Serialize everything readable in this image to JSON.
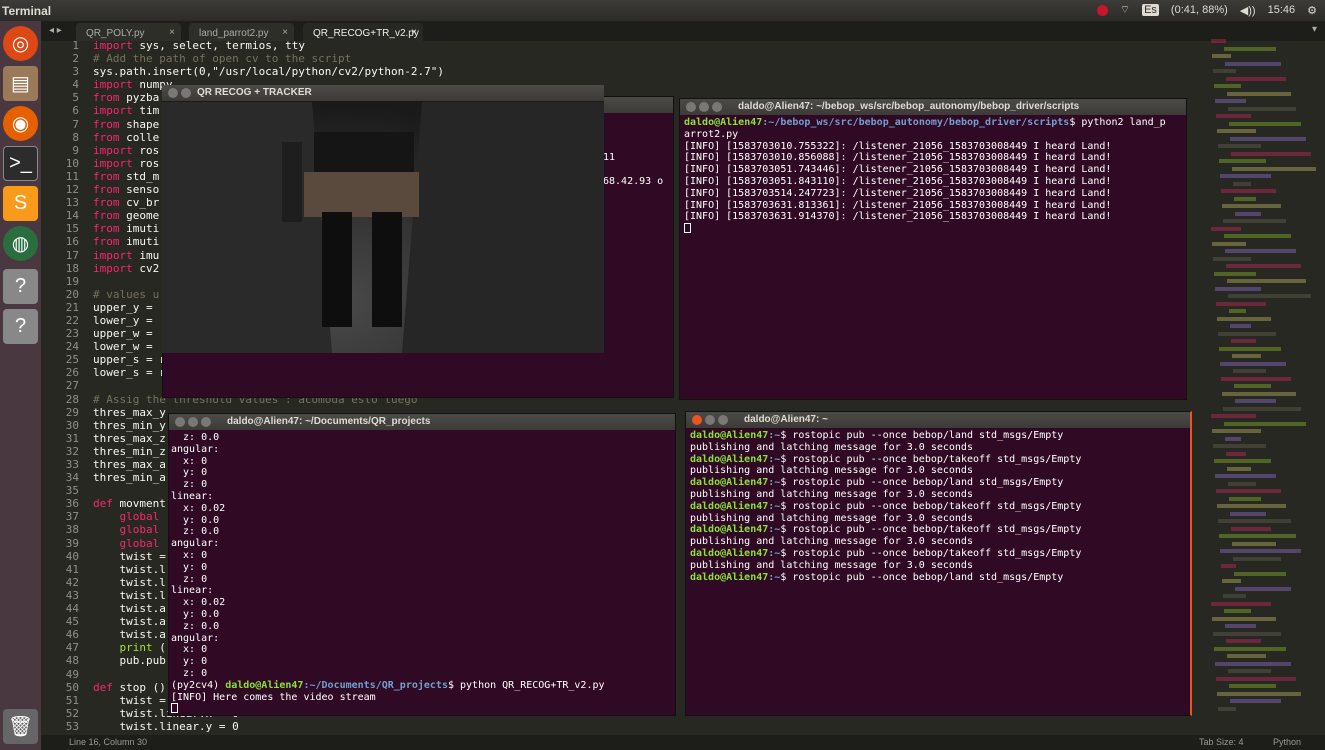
{
  "topbar": {
    "title": "Terminal",
    "keyboard": "Es",
    "battery": "(0:41, 88%)",
    "volume": "◀))",
    "time": "15:46"
  },
  "launcher": {
    "items": [
      "ubuntu-icon",
      "files-icon",
      "firefox-icon",
      "terminal-icon",
      "sublime-icon",
      "browser-icon",
      "unknown-icon",
      "unknown-icon",
      "trash-icon"
    ]
  },
  "editor": {
    "tabs": [
      "QR_POLY.py",
      "land_parrot2.py",
      "QR_RECOG+TR_v2.py"
    ],
    "status": {
      "position": "Line 16, Column 30",
      "tab_size": "Tab Size: 4",
      "language": "Python"
    },
    "line_numbers": [
      "1",
      "2",
      "3",
      "4",
      "5",
      "6",
      "7",
      "8",
      "9",
      "10",
      "11",
      "12",
      "13",
      "14",
      "15",
      "16",
      "17",
      "18",
      "19",
      "20",
      "21",
      "22",
      "23",
      "24",
      "25",
      "26",
      "27",
      "28",
      "29",
      "30",
      "31",
      "32",
      "33",
      "34",
      "35",
      "36",
      "37",
      "38",
      "39",
      "40",
      "41",
      "42",
      "43",
      "44",
      "45",
      "46",
      "47",
      "48",
      "49",
      "50",
      "51",
      "52",
      "53"
    ],
    "code": [
      "import sys, select, termios, tty",
      "# Add the path of open cv to the script",
      "sys.path.insert(0,\"/usr/local/python/cv2/python-2.7\")",
      "import numpy",
      "from pyzba",
      "import tim",
      "from shape",
      "from colle",
      "import ros",
      "import ros",
      "from std_m",
      "from senso",
      "from cv_br",
      "from geome",
      "from imuti",
      "from imuti",
      "import imu",
      "import cv2",
      "",
      "# values u",
      "upper_y = ",
      "lower_y = ",
      "upper_w = ",
      "lower_w = ",
      "upper_s = r",
      "lower_s = r",
      "",
      "# Assig the threshold values : acomoda esto luego",
      "thres_max_y",
      "thres_min_y",
      "thres_max_z",
      "thres_min_z",
      "thres_max_a",
      "thres_min_a",
      "",
      "def movment",
      "    global",
      "    global",
      "    global",
      "    twist =",
      "    twist.l",
      "    twist.l",
      "    twist.l",
      "    twist.a",
      "    twist.a",
      "    twist.a",
      "    print (",
      "    pub.pub",
      "",
      "def stop ()",
      "    twist =",
      "    twist.linear.x = 0",
      "    twist.linear.y = 0"
    ]
  },
  "qr_window": {
    "title": "QR RECOG + TRACKER"
  },
  "term_bg_left": {
    "lines": [
      "11",
      "68.42.93 o"
    ]
  },
  "term_scripts": {
    "title": "daldo@Alien47: ~/bebop_ws/src/bebop_autonomy/bebop_driver/scripts",
    "prompt_user": "daldo@Alien47",
    "prompt_path": ":~/bebop_ws/src/bebop_autonomy/bebop_driver/scripts",
    "command": "$ python2 land_p",
    "command_wrap": "arrot2.py",
    "lines": [
      "[INFO] [1583703010.755322]: /listener_21056_1583703008449 I heard Land!",
      "[INFO] [1583703010.856088]: /listener_21056_1583703008449 I heard Land!",
      "[INFO] [1583703051.743446]: /listener_21056_1583703008449 I heard Land!",
      "[INFO] [1583703051.843110]: /listener_21056_1583703008449 I heard Land!",
      "[INFO] [1583703514.247723]: /listener_21056_1583703008449 I heard Land!",
      "[INFO] [1583703631.813361]: /listener_21056_1583703008449 I heard Land!",
      "[INFO] [1583703631.914370]: /listener_21056_1583703008449 I heard Land!"
    ]
  },
  "term_projects": {
    "title": "daldo@Alien47: ~/Documents/QR_projects",
    "lines": [
      "  z: 0.0",
      "angular:",
      "  x: 0",
      "  y: 0",
      "  z: 0",
      "linear:",
      "  x: 0.02",
      "  y: 0.0",
      "  z: 0.0",
      "angular:",
      "  x: 0",
      "  y: 0",
      "  z: 0",
      "linear:",
      "  x: 0.02",
      "  y: 0.0",
      "  z: 0.0",
      "angular:",
      "  x: 0",
      "  y: 0",
      "  z: 0"
    ],
    "env": "(py2cv4) ",
    "prompt_user": "daldo@Alien47",
    "prompt_path": ":~/Documents/QR_projects",
    "command": "$ python QR_RECOG+TR_v2.py",
    "info": "[INFO] Here comes the video stream"
  },
  "term_home": {
    "title": "daldo@Alien47: ~",
    "prompt_user": "daldo@Alien47",
    "prompt_path": ":~",
    "entries": [
      {
        "cmd": "$ rostopic pub --once bebop/land std_msgs/Empty",
        "out": "publishing and latching message for 3.0 seconds"
      },
      {
        "cmd": "$ rostopic pub --once bebop/takeoff std_msgs/Empty",
        "out": "publishing and latching message for 3.0 seconds"
      },
      {
        "cmd": "$ rostopic pub --once bebop/land std_msgs/Empty",
        "out": "publishing and latching message for 3.0 seconds"
      },
      {
        "cmd": "$ rostopic pub --once bebop/takeoff std_msgs/Empty",
        "out": "publishing and latching message for 3.0 seconds"
      },
      {
        "cmd": "$ rostopic pub --once bebop/takeoff std_msgs/Empty",
        "out": "publishing and latching message for 3.0 seconds"
      },
      {
        "cmd": "$ rostopic pub --once bebop/takeoff std_msgs/Empty",
        "out": "publishing and latching message for 3.0 seconds"
      },
      {
        "cmd": "$ rostopic pub --once bebop/land std_msgs/Empty",
        "out": ""
      }
    ]
  }
}
